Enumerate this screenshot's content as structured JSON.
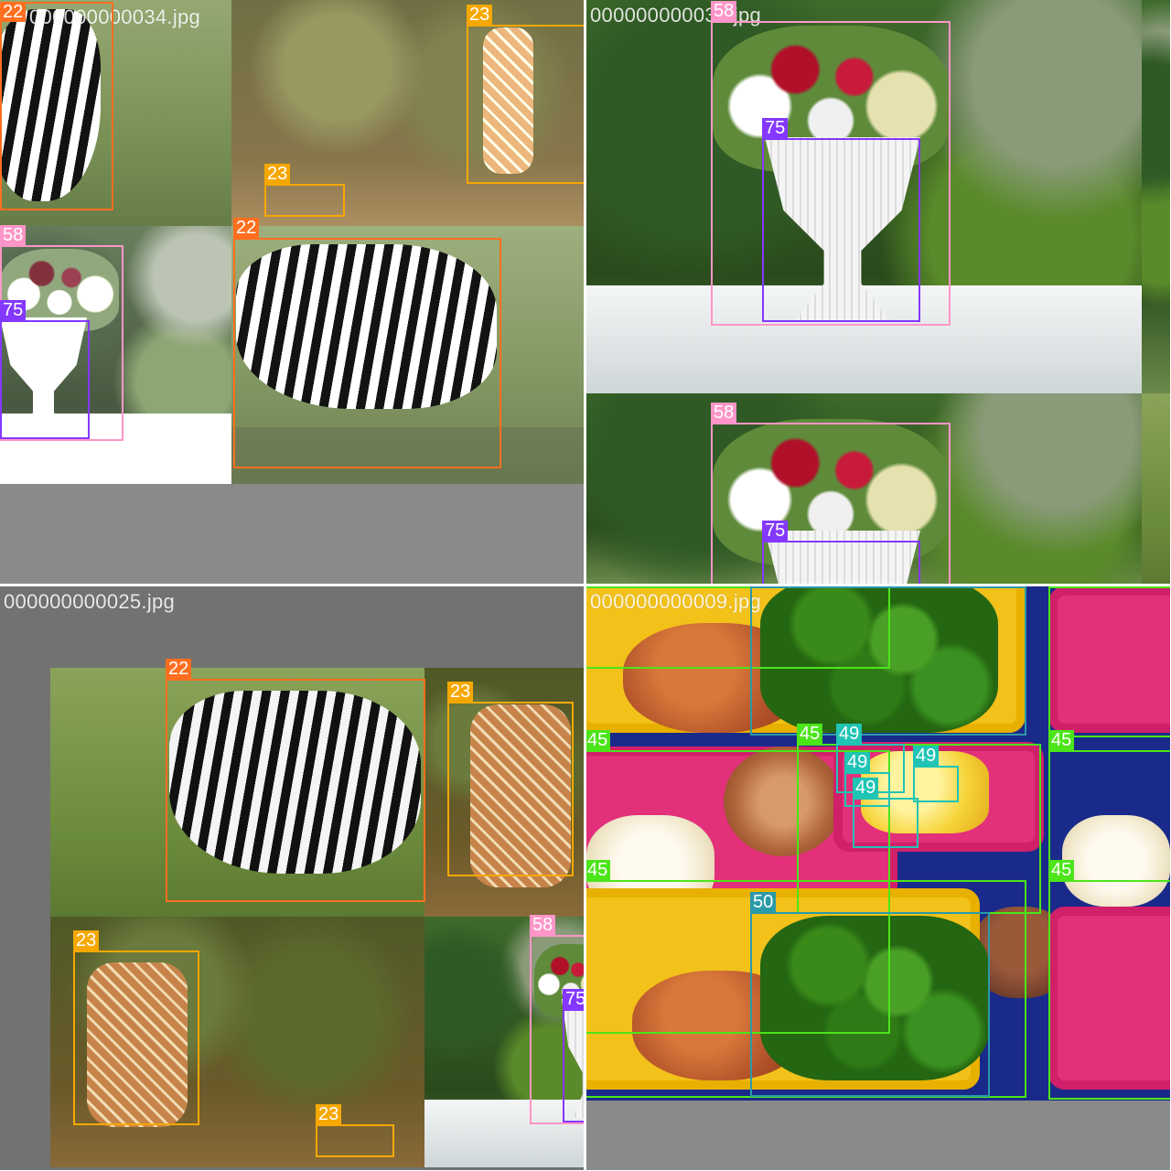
{
  "mosaic": {
    "tiles": [
      {
        "filename": "000000000034.jpg",
        "boxes": [
          {
            "label": "22",
            "color": "#ff6f1f"
          },
          {
            "label": "23",
            "color": "#f6a800"
          },
          {
            "label": "23",
            "color": "#f6a800"
          },
          {
            "label": "22",
            "color": "#ff6f1f"
          },
          {
            "label": "58",
            "color": "#ff95c8"
          },
          {
            "label": "75",
            "color": "#8438ff"
          }
        ]
      },
      {
        "filename": "000000000030.jpg",
        "boxes": [
          {
            "label": "58",
            "color": "#ff95c8"
          },
          {
            "label": "75",
            "color": "#8438ff"
          },
          {
            "label": "58",
            "color": "#ff95c8"
          },
          {
            "label": "75",
            "color": "#8438ff"
          }
        ]
      },
      {
        "filename": "000000000025.jpg",
        "boxes": [
          {
            "label": "22",
            "color": "#ff6f1f"
          },
          {
            "label": "23",
            "color": "#f6a800"
          },
          {
            "label": "23",
            "color": "#f6a800"
          },
          {
            "label": "23",
            "color": "#f6a800"
          },
          {
            "label": "58",
            "color": "#ff95c8"
          },
          {
            "label": "75",
            "color": "#8438ff"
          }
        ]
      },
      {
        "filename": "000000000009.jpg",
        "boxes": [
          {
            "label": "45",
            "color": "#4ce51a"
          },
          {
            "label": "50",
            "color": "#2a9aa8"
          },
          {
            "label": "45",
            "color": "#4ce51a"
          },
          {
            "label": "45",
            "color": "#4ce51a"
          },
          {
            "label": "45",
            "color": "#4ce51a"
          },
          {
            "label": "49",
            "color": "#1fc4b4"
          },
          {
            "label": "49",
            "color": "#1fc4b4"
          },
          {
            "label": "49",
            "color": "#1fc4b4"
          },
          {
            "label": "49",
            "color": "#1fc4b4"
          },
          {
            "label": "45",
            "color": "#4ce51a"
          },
          {
            "label": "45",
            "color": "#4ce51a"
          },
          {
            "label": "50",
            "color": "#2a9aa8"
          },
          {
            "label": "45",
            "color": "#4ce51a"
          },
          {
            "label": "45",
            "color": "#4ce51a"
          }
        ]
      }
    ]
  }
}
